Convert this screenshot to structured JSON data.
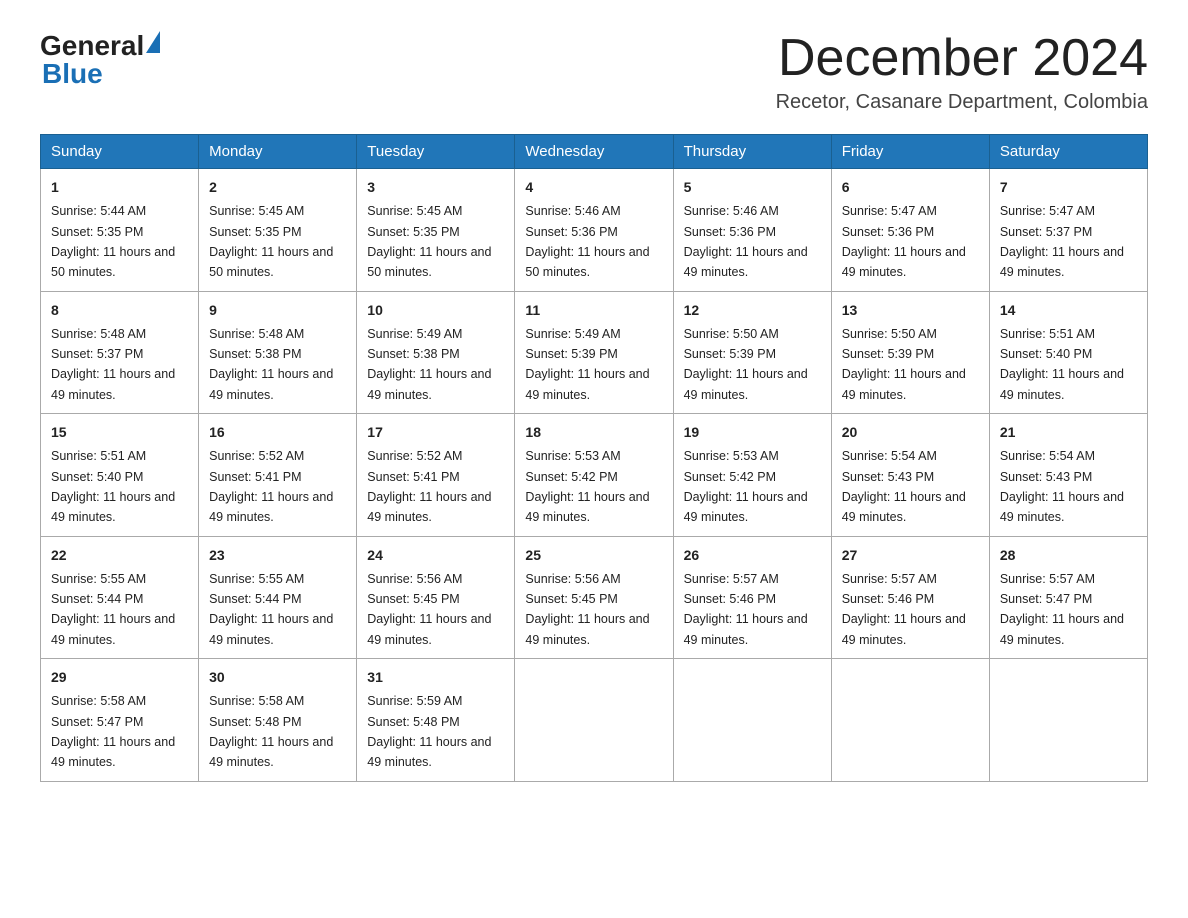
{
  "logo": {
    "general": "General",
    "blue": "Blue",
    "triangle_color": "#1a6fb5"
  },
  "title": {
    "month_year": "December 2024",
    "location": "Recetor, Casanare Department, Colombia"
  },
  "header": {
    "days": [
      "Sunday",
      "Monday",
      "Tuesday",
      "Wednesday",
      "Thursday",
      "Friday",
      "Saturday"
    ]
  },
  "weeks": [
    [
      {
        "day": "1",
        "sunrise": "5:44 AM",
        "sunset": "5:35 PM",
        "daylight": "11 hours and 50 minutes."
      },
      {
        "day": "2",
        "sunrise": "5:45 AM",
        "sunset": "5:35 PM",
        "daylight": "11 hours and 50 minutes."
      },
      {
        "day": "3",
        "sunrise": "5:45 AM",
        "sunset": "5:35 PM",
        "daylight": "11 hours and 50 minutes."
      },
      {
        "day": "4",
        "sunrise": "5:46 AM",
        "sunset": "5:36 PM",
        "daylight": "11 hours and 50 minutes."
      },
      {
        "day": "5",
        "sunrise": "5:46 AM",
        "sunset": "5:36 PM",
        "daylight": "11 hours and 49 minutes."
      },
      {
        "day": "6",
        "sunrise": "5:47 AM",
        "sunset": "5:36 PM",
        "daylight": "11 hours and 49 minutes."
      },
      {
        "day": "7",
        "sunrise": "5:47 AM",
        "sunset": "5:37 PM",
        "daylight": "11 hours and 49 minutes."
      }
    ],
    [
      {
        "day": "8",
        "sunrise": "5:48 AM",
        "sunset": "5:37 PM",
        "daylight": "11 hours and 49 minutes."
      },
      {
        "day": "9",
        "sunrise": "5:48 AM",
        "sunset": "5:38 PM",
        "daylight": "11 hours and 49 minutes."
      },
      {
        "day": "10",
        "sunrise": "5:49 AM",
        "sunset": "5:38 PM",
        "daylight": "11 hours and 49 minutes."
      },
      {
        "day": "11",
        "sunrise": "5:49 AM",
        "sunset": "5:39 PM",
        "daylight": "11 hours and 49 minutes."
      },
      {
        "day": "12",
        "sunrise": "5:50 AM",
        "sunset": "5:39 PM",
        "daylight": "11 hours and 49 minutes."
      },
      {
        "day": "13",
        "sunrise": "5:50 AM",
        "sunset": "5:39 PM",
        "daylight": "11 hours and 49 minutes."
      },
      {
        "day": "14",
        "sunrise": "5:51 AM",
        "sunset": "5:40 PM",
        "daylight": "11 hours and 49 minutes."
      }
    ],
    [
      {
        "day": "15",
        "sunrise": "5:51 AM",
        "sunset": "5:40 PM",
        "daylight": "11 hours and 49 minutes."
      },
      {
        "day": "16",
        "sunrise": "5:52 AM",
        "sunset": "5:41 PM",
        "daylight": "11 hours and 49 minutes."
      },
      {
        "day": "17",
        "sunrise": "5:52 AM",
        "sunset": "5:41 PM",
        "daylight": "11 hours and 49 minutes."
      },
      {
        "day": "18",
        "sunrise": "5:53 AM",
        "sunset": "5:42 PM",
        "daylight": "11 hours and 49 minutes."
      },
      {
        "day": "19",
        "sunrise": "5:53 AM",
        "sunset": "5:42 PM",
        "daylight": "11 hours and 49 minutes."
      },
      {
        "day": "20",
        "sunrise": "5:54 AM",
        "sunset": "5:43 PM",
        "daylight": "11 hours and 49 minutes."
      },
      {
        "day": "21",
        "sunrise": "5:54 AM",
        "sunset": "5:43 PM",
        "daylight": "11 hours and 49 minutes."
      }
    ],
    [
      {
        "day": "22",
        "sunrise": "5:55 AM",
        "sunset": "5:44 PM",
        "daylight": "11 hours and 49 minutes."
      },
      {
        "day": "23",
        "sunrise": "5:55 AM",
        "sunset": "5:44 PM",
        "daylight": "11 hours and 49 minutes."
      },
      {
        "day": "24",
        "sunrise": "5:56 AM",
        "sunset": "5:45 PM",
        "daylight": "11 hours and 49 minutes."
      },
      {
        "day": "25",
        "sunrise": "5:56 AM",
        "sunset": "5:45 PM",
        "daylight": "11 hours and 49 minutes."
      },
      {
        "day": "26",
        "sunrise": "5:57 AM",
        "sunset": "5:46 PM",
        "daylight": "11 hours and 49 minutes."
      },
      {
        "day": "27",
        "sunrise": "5:57 AM",
        "sunset": "5:46 PM",
        "daylight": "11 hours and 49 minutes."
      },
      {
        "day": "28",
        "sunrise": "5:57 AM",
        "sunset": "5:47 PM",
        "daylight": "11 hours and 49 minutes."
      }
    ],
    [
      {
        "day": "29",
        "sunrise": "5:58 AM",
        "sunset": "5:47 PM",
        "daylight": "11 hours and 49 minutes."
      },
      {
        "day": "30",
        "sunrise": "5:58 AM",
        "sunset": "5:48 PM",
        "daylight": "11 hours and 49 minutes."
      },
      {
        "day": "31",
        "sunrise": "5:59 AM",
        "sunset": "5:48 PM",
        "daylight": "11 hours and 49 minutes."
      },
      null,
      null,
      null,
      null
    ]
  ]
}
